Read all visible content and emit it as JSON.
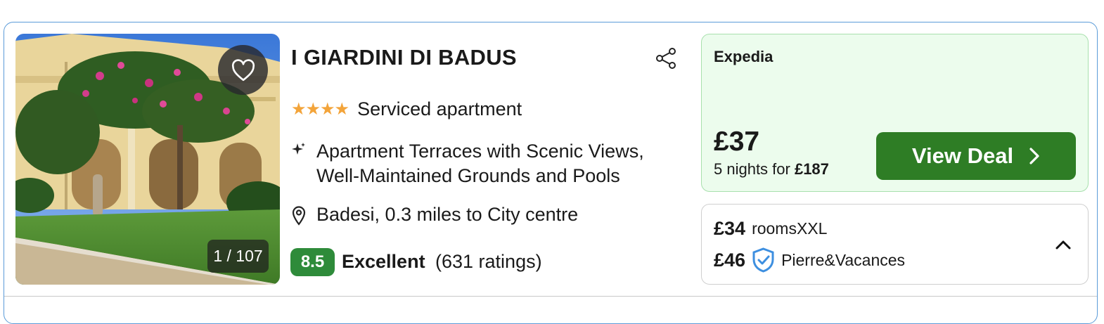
{
  "listing": {
    "photo_counter": "1 / 107",
    "title": "I GIARDINI DI BADUS",
    "stars": "★★★★",
    "star_count": 4,
    "type": "Serviced apartment",
    "feature": "Apartment Terraces with Scenic Views, Well-Maintained Grounds and Pools",
    "location": "Badesi, 0.3 miles to City centre",
    "score": "8.5",
    "score_label": "Excellent",
    "score_count": "(631 ratings)",
    "icons": {
      "favorite": "heart-icon",
      "share": "share-icon",
      "feature": "sparkle-icon",
      "location": "map-pin-icon"
    }
  },
  "deal": {
    "provider": "Expedia",
    "price": "£37",
    "nights_text": "5 nights for ",
    "total": "£187",
    "button_label": "View Deal",
    "button_icon": "chevron-right-icon"
  },
  "alternatives": [
    {
      "price": "£34",
      "provider": "roomsXXL",
      "verified": false
    },
    {
      "price": "£46",
      "provider": "Pierre&Vacances",
      "verified": true
    }
  ],
  "colors": {
    "accent_border": "#5b9bd8",
    "score_green": "#2e8b3a",
    "deal_button": "#2e7d25",
    "deal_bg": "#ecfced",
    "stars": "#f3a43a",
    "shield": "#3d8fe0"
  }
}
